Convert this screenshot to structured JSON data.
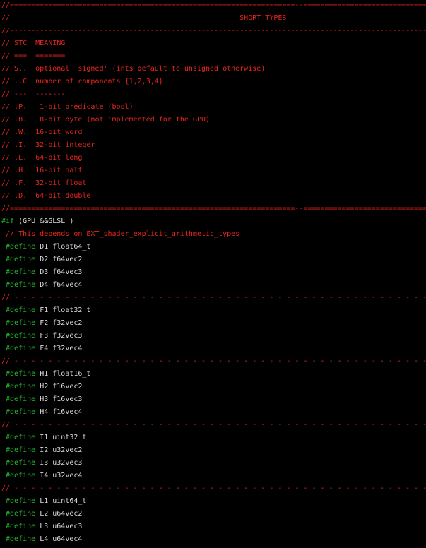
{
  "theme": {
    "background": "#000000",
    "comment": "#e8261c",
    "preprocessor": "#24b82a",
    "text": "#d9d9d9"
  },
  "lines": [
    [
      {
        "t": "//===================================================================--=================================",
        "k": "comment"
      }
    ],
    [
      {
        "t": "//                                                      SHORT TYPES",
        "k": "comment"
      }
    ],
    [
      {
        "t": "//-------------------------------------------------------------------------------------------------------",
        "k": "comment"
      }
    ],
    [
      {
        "t": "// STC  MEANING",
        "k": "comment"
      }
    ],
    [
      {
        "t": "// ===  =======",
        "k": "comment"
      }
    ],
    [
      {
        "t": "// S..  optional 'signed' (ints default to unsigned otherwise)",
        "k": "comment"
      }
    ],
    [
      {
        "t": "// ..C  number of components {1,2,3,4}",
        "k": "comment"
      }
    ],
    [
      {
        "t": "// ---  -------",
        "k": "comment"
      }
    ],
    [
      {
        "t": "// .P.   1-bit predicate (bool)",
        "k": "comment"
      }
    ],
    [
      {
        "t": "// .B.   8-bit byte (not implemented for the GPU)",
        "k": "comment"
      }
    ],
    [
      {
        "t": "// .W.  16-bit word",
        "k": "comment"
      }
    ],
    [
      {
        "t": "// .I.  32-bit integer",
        "k": "comment"
      }
    ],
    [
      {
        "t": "// .L.  64-bit long",
        "k": "comment"
      }
    ],
    [
      {
        "t": "// .H.  16-bit half",
        "k": "comment"
      }
    ],
    [
      {
        "t": "// .F.  32-bit float",
        "k": "comment"
      }
    ],
    [
      {
        "t": "// .D.  64-bit double",
        "k": "comment"
      }
    ],
    [
      {
        "t": "//===================================================================--=================================",
        "k": "comment"
      }
    ],
    [
      {
        "t": "#if",
        "k": "preprocessor"
      },
      {
        "t": " (GPU_&&GLSL_)",
        "k": "text"
      }
    ],
    [
      {
        "t": " // This depends on EXT_shader_explicit_arithmetic_types",
        "k": "comment"
      }
    ],
    [
      {
        "t": " #define",
        "k": "preprocessor"
      },
      {
        "t": " D1 float64_t",
        "k": "text"
      }
    ],
    [
      {
        "t": " #define",
        "k": "preprocessor"
      },
      {
        "t": " D2 f64vec2",
        "k": "text"
      }
    ],
    [
      {
        "t": " #define",
        "k": "preprocessor"
      },
      {
        "t": " D3 f64vec3",
        "k": "text"
      }
    ],
    [
      {
        "t": " #define",
        "k": "preprocessor"
      },
      {
        "t": " D4 f64vec4",
        "k": "text"
      }
    ],
    [
      {
        "t": "// - - - - - - - - - - - - - - - - - - - - - - - - - - - - - - - - - - - - - - - - - - - - - - - - - - -",
        "k": "comment"
      }
    ],
    [
      {
        "t": " #define",
        "k": "preprocessor"
      },
      {
        "t": " F1 float32_t",
        "k": "text"
      }
    ],
    [
      {
        "t": " #define",
        "k": "preprocessor"
      },
      {
        "t": " F2 f32vec2",
        "k": "text"
      }
    ],
    [
      {
        "t": " #define",
        "k": "preprocessor"
      },
      {
        "t": " F3 f32vec3",
        "k": "text"
      }
    ],
    [
      {
        "t": " #define",
        "k": "preprocessor"
      },
      {
        "t": " F4 f32vec4",
        "k": "text"
      }
    ],
    [
      {
        "t": "// - - - - - - - - - - - - - - - - - - - - - - - - - - - - - - - - - - - - - - - - - - - - - - - - - - -",
        "k": "comment"
      }
    ],
    [
      {
        "t": " #define",
        "k": "preprocessor"
      },
      {
        "t": " H1 float16_t",
        "k": "text"
      }
    ],
    [
      {
        "t": " #define",
        "k": "preprocessor"
      },
      {
        "t": " H2 f16vec2",
        "k": "text"
      }
    ],
    [
      {
        "t": " #define",
        "k": "preprocessor"
      },
      {
        "t": " H3 f16vec3",
        "k": "text"
      }
    ],
    [
      {
        "t": " #define",
        "k": "preprocessor"
      },
      {
        "t": " H4 f16vec4",
        "k": "text"
      }
    ],
    [
      {
        "t": "// - - - - - - - - - - - - - - - - - - - - - - - - - - - - - - - - - - - - - - - - - - - - - - - - - - -",
        "k": "comment"
      }
    ],
    [
      {
        "t": " #define",
        "k": "preprocessor"
      },
      {
        "t": " I1 uint32_t",
        "k": "text"
      }
    ],
    [
      {
        "t": " #define",
        "k": "preprocessor"
      },
      {
        "t": " I2 u32vec2",
        "k": "text"
      }
    ],
    [
      {
        "t": " #define",
        "k": "preprocessor"
      },
      {
        "t": " I3 u32vec3",
        "k": "text"
      }
    ],
    [
      {
        "t": " #define",
        "k": "preprocessor"
      },
      {
        "t": " I4 u32vec4",
        "k": "text"
      }
    ],
    [
      {
        "t": "// - - - - - - - - - - - - - - - - - - - - - - - - - - - - - - - - - - - - - - - - - - - - - - - - - - -",
        "k": "comment"
      }
    ],
    [
      {
        "t": " #define",
        "k": "preprocessor"
      },
      {
        "t": " L1 uint64_t",
        "k": "text"
      }
    ],
    [
      {
        "t": " #define",
        "k": "preprocessor"
      },
      {
        "t": " L2 u64vec2",
        "k": "text"
      }
    ],
    [
      {
        "t": " #define",
        "k": "preprocessor"
      },
      {
        "t": " L3 u64vec3",
        "k": "text"
      }
    ],
    [
      {
        "t": " #define",
        "k": "preprocessor"
      },
      {
        "t": " L4 u64vec4",
        "k": "text"
      }
    ]
  ]
}
